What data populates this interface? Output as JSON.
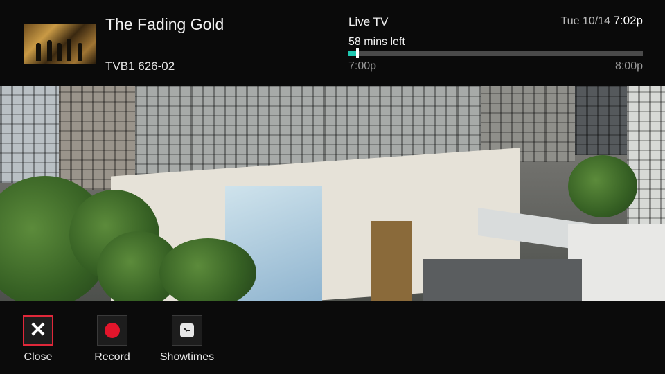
{
  "program": {
    "title": "The Fading Gold",
    "channel": "TVB1 626-02"
  },
  "status": {
    "live_label": "Live TV",
    "remaining": "58 mins left",
    "start_time": "7:00p",
    "end_time": "8:00p",
    "progress_fraction": 0.03
  },
  "clock": {
    "date": "Tue 10/14",
    "time": "7:02p"
  },
  "actions": [
    {
      "label": "Close",
      "icon": "close-icon"
    },
    {
      "label": "Record",
      "icon": "record-icon"
    },
    {
      "label": "Showtimes",
      "icon": "clock-icon"
    }
  ],
  "colors": {
    "progress_accent": "#1fc7b0",
    "record_red": "#e3152b",
    "selection_border": "#e0283a"
  }
}
